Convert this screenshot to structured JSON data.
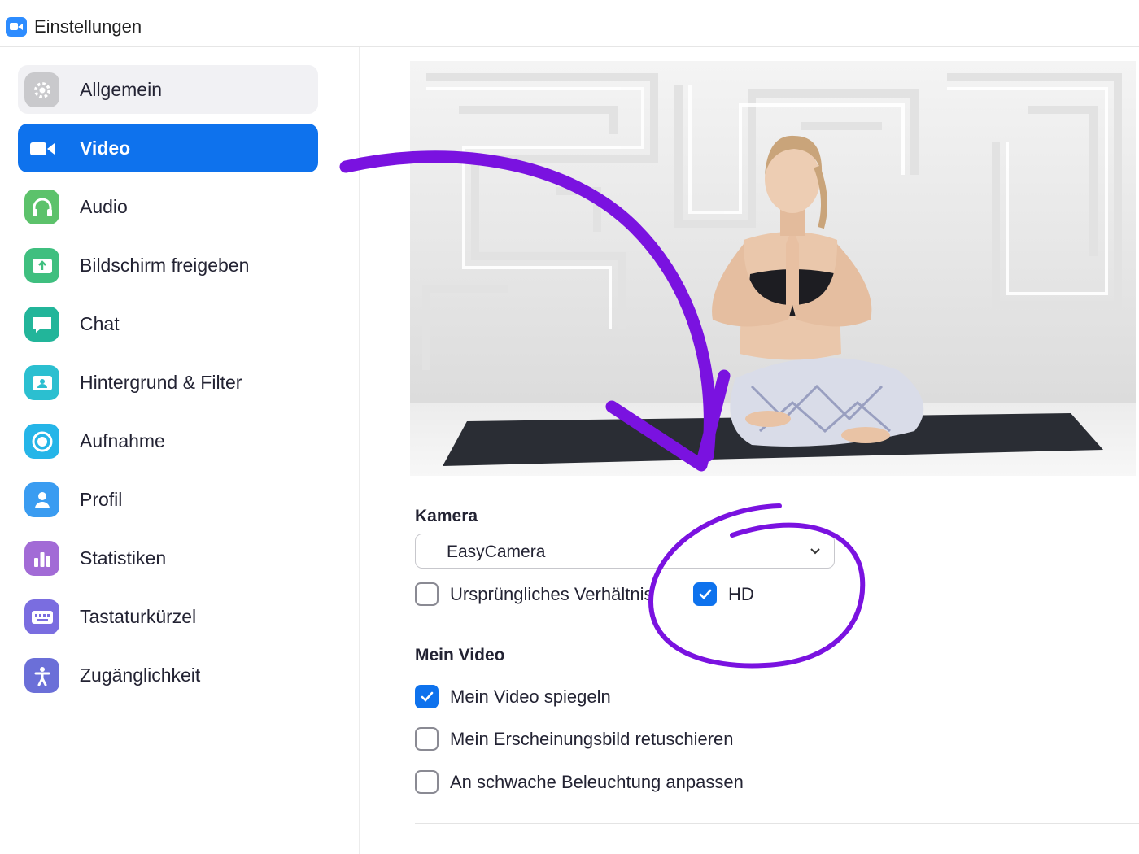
{
  "window": {
    "title": "Einstellungen"
  },
  "sidebar": {
    "items": [
      {
        "label": "Allgemein",
        "icon": "gear-icon",
        "color": "#c9c9cc"
      },
      {
        "label": "Video",
        "icon": "video-camera-icon",
        "color": "#0e72ed"
      },
      {
        "label": "Audio",
        "icon": "headphones-icon",
        "color": "#5cc26b"
      },
      {
        "label": "Bildschirm freigeben",
        "icon": "share-screen-icon",
        "color": "#3fbf7f"
      },
      {
        "label": "Chat",
        "icon": "chat-bubble-icon",
        "color": "#22b59a"
      },
      {
        "label": "Hintergrund & Filter",
        "icon": "background-person-icon",
        "color": "#2bbfd0"
      },
      {
        "label": "Aufnahme",
        "icon": "record-icon",
        "color": "#25b5e8"
      },
      {
        "label": "Profil",
        "icon": "profile-person-icon",
        "color": "#3a9cf1"
      },
      {
        "label": "Statistiken",
        "icon": "bar-chart-icon",
        "color": "#a26bd6"
      },
      {
        "label": "Tastaturkürzel",
        "icon": "keyboard-icon",
        "color": "#7a6de0"
      },
      {
        "label": "Zugänglichkeit",
        "icon": "accessibility-icon",
        "color": "#6b6fd8"
      }
    ]
  },
  "main": {
    "camera": {
      "section_label": "Kamera",
      "selected_camera": "EasyCamera",
      "options": [
        {
          "label": "Ursprüngliches Verhältnis",
          "checked": false
        },
        {
          "label": "HD",
          "checked": true
        }
      ]
    },
    "my_video": {
      "section_label": "Mein Video",
      "options": [
        {
          "label": "Mein Video spiegeln",
          "checked": true
        },
        {
          "label": "Mein Erscheinungsbild retuschieren",
          "checked": false
        },
        {
          "label": "An schwache Beleuchtung anpassen",
          "checked": false
        }
      ]
    }
  },
  "colors": {
    "accent": "#0e72ed",
    "annotation": "#7a12e0"
  }
}
